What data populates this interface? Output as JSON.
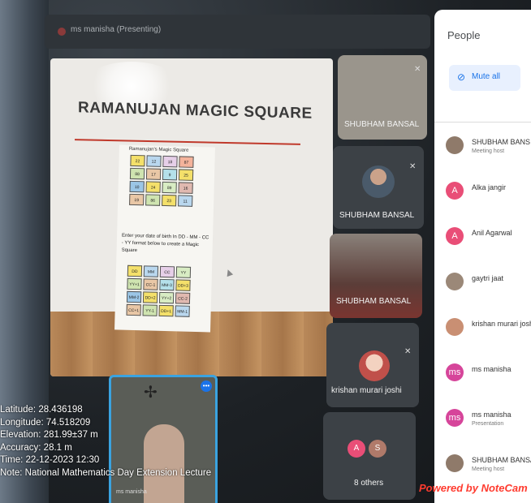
{
  "meeting": {
    "presenter_label": "ms manisha (Presenting)"
  },
  "slide": {
    "title": "RAMANUJAN MAGIC SQUARE",
    "page_subtitle": "Ramanujan's Magic Square",
    "grid1": [
      {
        "v": "22",
        "c": "#f4e06a"
      },
      {
        "v": "12",
        "c": "#b9d7ee"
      },
      {
        "v": "18",
        "c": "#e6cfe8"
      },
      {
        "v": "87",
        "c": "#f4b39b"
      },
      {
        "v": "88",
        "c": "#cfe4b0"
      },
      {
        "v": "17",
        "c": "#e9c7a6"
      },
      {
        "v": "9",
        "c": "#b4e0ea"
      },
      {
        "v": "25",
        "c": "#f4e06a"
      },
      {
        "v": "10",
        "c": "#9bc6e6"
      },
      {
        "v": "24",
        "c": "#f4e06a"
      },
      {
        "v": "89",
        "c": "#d8ecc3"
      },
      {
        "v": "16",
        "c": "#e0b9b0"
      },
      {
        "v": "19",
        "c": "#e9c7a6"
      },
      {
        "v": "86",
        "c": "#cfe4b0"
      },
      {
        "v": "23",
        "c": "#f4e06a"
      },
      {
        "v": "11",
        "c": "#b9d7ee"
      }
    ],
    "instruction": "Enter your  date of birth In DD - MM - CC - YY format below to create a Magic Square",
    "grid2": [
      {
        "v": "DD",
        "c": "#f4e06a"
      },
      {
        "v": "MM",
        "c": "#b9d7ee"
      },
      {
        "v": "CC",
        "c": "#e6cfe8"
      },
      {
        "v": "YY",
        "c": "#d8ecc3"
      },
      {
        "v": "YY+1",
        "c": "#cfe4b0"
      },
      {
        "v": "CC-1",
        "c": "#e9c7a6"
      },
      {
        "v": "MM-3",
        "c": "#b4e0ea"
      },
      {
        "v": "DD+3",
        "c": "#f4e06a"
      },
      {
        "v": "MM-2",
        "c": "#9bc6e6"
      },
      {
        "v": "DD+2",
        "c": "#f4e06a"
      },
      {
        "v": "YY+2",
        "c": "#d8ecc3"
      },
      {
        "v": "CC-2",
        "c": "#e0b9b0"
      },
      {
        "v": "CC+1",
        "c": "#e9c7a6"
      },
      {
        "v": "YY-1",
        "c": "#cfe4b0"
      },
      {
        "v": "DD+1",
        "c": "#f4e06a"
      },
      {
        "v": "MM-1",
        "c": "#b9d7ee"
      }
    ]
  },
  "tiles": {
    "t1_name": "SHUBHAM BANSAL",
    "t2_name": "SHUBHAM BANSAL",
    "t3_name": "SHUBHAM BANSAL",
    "t4_name": "krishan murari joshi",
    "t5_name": "8 others",
    "others_initials": [
      "A",
      "S"
    ]
  },
  "selfview": {
    "name": "ms manisha",
    "more_label": "•••"
  },
  "people_panel": {
    "title": "People",
    "mute_all": "Mute all",
    "participants": [
      {
        "name": "SHUBHAM BANS",
        "role": "Meeting host",
        "initial": "",
        "color": "#8f7a6a"
      },
      {
        "name": "Alka jangir",
        "role": "",
        "initial": "A",
        "color": "#e94e77"
      },
      {
        "name": "Anil Agarwal",
        "role": "",
        "initial": "A",
        "color": "#e94e77"
      },
      {
        "name": "gaytri jaat",
        "role": "",
        "initial": "",
        "color": "#9b8878"
      },
      {
        "name": "krishan murari josh",
        "role": "",
        "initial": "",
        "color": "#c98f73"
      },
      {
        "name": "ms manisha",
        "role": "",
        "initial": "ms",
        "color": "#d6459a"
      },
      {
        "name": "ms manisha",
        "role": "Presentation",
        "initial": "ms",
        "color": "#d6459a"
      },
      {
        "name": "SHUBHAM BANSAL",
        "role": "Meeting host",
        "initial": "",
        "color": "#8f7a6a"
      }
    ]
  },
  "geo_overlay": {
    "latitude": "Latitude: 28.436198",
    "longitude": "Longitude: 74.518209",
    "elevation": "Elevation: 281.99±37 m",
    "accuracy": "Accuracy: 28.1 m",
    "time": "Time: 22-12-2023 12:30",
    "note": "Note: National Mathematics Day Extension Lecture"
  },
  "watermark": "Powered by NoteCam"
}
